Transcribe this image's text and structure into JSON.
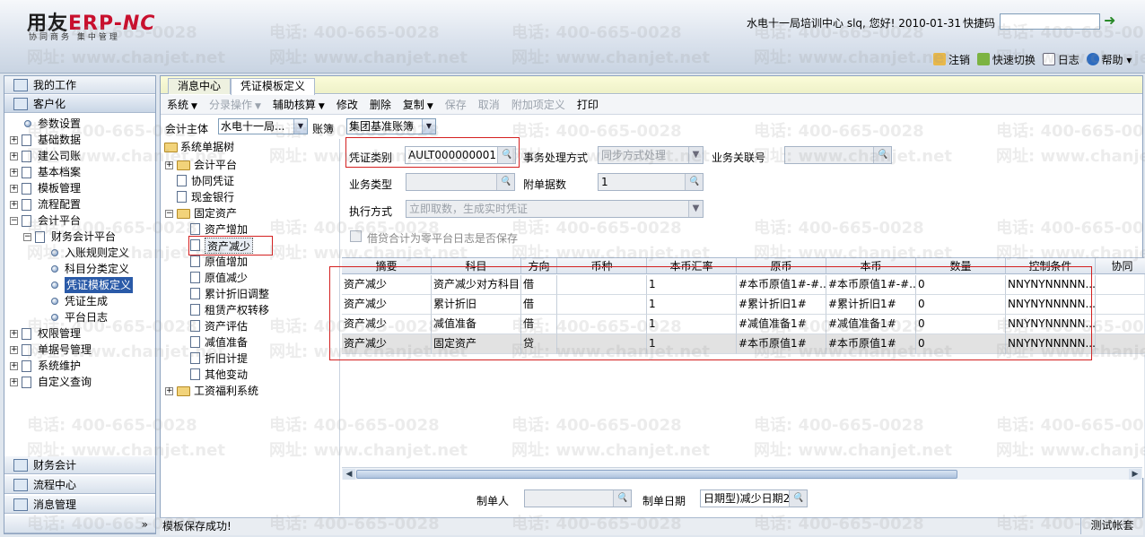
{
  "header": {
    "logo_brand": "用友",
    "logo_erp": "ERP-",
    "logo_nc": "NC",
    "logo_sub": "协同商务  集中管理",
    "user_info": "水电十一局培训中心 slq, 您好! 2010-01-31",
    "shortcut_label": "快捷码",
    "links": [
      "注销",
      "快速切换",
      "日志",
      "帮助"
    ]
  },
  "nav": {
    "top_sections": [
      "我的工作",
      "客户化"
    ],
    "tree": [
      {
        "label": "参数设置",
        "type": "leaf"
      },
      {
        "label": "基础数据",
        "type": "group"
      },
      {
        "label": "建公司账",
        "type": "group"
      },
      {
        "label": "基本档案",
        "type": "group"
      },
      {
        "label": "模板管理",
        "type": "group"
      },
      {
        "label": "流程配置",
        "type": "group"
      },
      {
        "label": "会计平台",
        "type": "open"
      },
      {
        "label": "财务会计平台",
        "type": "open"
      },
      {
        "label": "入账规则定义",
        "type": "leaf"
      },
      {
        "label": "科目分类定义",
        "type": "leaf"
      },
      {
        "label": "凭证模板定义",
        "type": "leaf",
        "selected": true
      },
      {
        "label": "凭证生成",
        "type": "leaf"
      },
      {
        "label": "平台日志",
        "type": "leaf"
      },
      {
        "label": "权限管理",
        "type": "group"
      },
      {
        "label": "单据号管理",
        "type": "group"
      },
      {
        "label": "系统维护",
        "type": "group"
      },
      {
        "label": "自定义查询",
        "type": "group"
      }
    ],
    "bottom_sections": [
      "财务会计",
      "流程中心",
      "消息管理"
    ],
    "collapse_glyph": "»"
  },
  "tabs": [
    "消息中心",
    "凭证模板定义"
  ],
  "menu": [
    {
      "label": "系统",
      "arrow": true,
      "enabled": true
    },
    {
      "label": "分录操作",
      "arrow": true,
      "enabled": false
    },
    {
      "label": "辅助核算",
      "arrow": true,
      "enabled": true
    },
    {
      "label": "修改",
      "enabled": true
    },
    {
      "label": "删除",
      "enabled": true
    },
    {
      "label": "复制",
      "arrow": true,
      "enabled": true
    },
    {
      "label": "保存",
      "enabled": false
    },
    {
      "label": "取消",
      "enabled": false
    },
    {
      "label": "附加项定义",
      "enabled": false
    },
    {
      "label": "打印",
      "enabled": true
    }
  ],
  "filter": {
    "entity_label": "会计主体",
    "entity_value": "水电十一局...",
    "book_label": "账簿",
    "book_value": "集团基准账簿"
  },
  "doc_tree": {
    "root": "系统单据树",
    "items": [
      {
        "label": "会计平台",
        "kind": "folder-closed"
      },
      {
        "label": "协同凭证",
        "kind": "doc"
      },
      {
        "label": "现金银行",
        "kind": "doc"
      },
      {
        "label": "固定资产",
        "kind": "folder-open"
      },
      {
        "label": "资产增加",
        "kind": "doc"
      },
      {
        "label": "资产减少",
        "kind": "doc",
        "selected": true
      },
      {
        "label": "原值增加",
        "kind": "doc"
      },
      {
        "label": "原值减少",
        "kind": "doc"
      },
      {
        "label": "累计折旧调整",
        "kind": "doc"
      },
      {
        "label": "租赁产权转移",
        "kind": "doc"
      },
      {
        "label": "资产评估",
        "kind": "doc"
      },
      {
        "label": "减值准备",
        "kind": "doc"
      },
      {
        "label": "折旧计提",
        "kind": "doc"
      },
      {
        "label": "其他变动",
        "kind": "doc"
      },
      {
        "label": "工资福利系统",
        "kind": "folder-closed"
      }
    ]
  },
  "form": {
    "voucher_type_label": "凭证类别",
    "voucher_type_value": "AULT000000001\")",
    "process_label": "事务处理方式",
    "process_value": "同步方式处理",
    "biz_link_label": "业务关联号",
    "biz_link_value": "",
    "biz_type_label": "业务类型",
    "biz_type_value": "",
    "attach_label": "附单据数",
    "attach_value": "1",
    "exec_label": "执行方式",
    "exec_value": "立即取数，生成实时凭证",
    "checkbox_label": "借贷合计为零平台日志是否保存"
  },
  "grid": {
    "columns": [
      "摘要",
      "科目",
      "方向",
      "币种",
      "本币汇率",
      "原币",
      "本币",
      "数量",
      "控制条件",
      "协同"
    ],
    "rows": [
      [
        "资产减少",
        "资产减少对方科目",
        "借",
        "",
        "1",
        "#本币原值1#-#...",
        "#本币原值1#-#...",
        "0",
        "NNYNYNNNNN...",
        ""
      ],
      [
        "资产减少",
        "累计折旧",
        "借",
        "",
        "1",
        "#累计折旧1#",
        "#累计折旧1#",
        "0",
        "NNYNYNNNNN...",
        ""
      ],
      [
        "资产减少",
        "减值准备",
        "借",
        "",
        "1",
        "#减值准备1#",
        "#减值准备1#",
        "0",
        "NNYNYNNNNN...",
        ""
      ],
      [
        "资产减少",
        "固定资产",
        "贷",
        "",
        "1",
        "#本币原值1#",
        "#本币原值1#",
        "0",
        "NNYNYNNNNN...",
        ""
      ]
    ]
  },
  "footer": {
    "maker_label": "制单人",
    "maker_value": "",
    "date_label": "制单日期",
    "date_value": "日期型)减少日期2#"
  },
  "status": {
    "message": "模板保存成功!",
    "right": "测试帐套"
  },
  "watermark": {
    "phone": "电话: 400-665-0028",
    "site": "网址: www.chanjet.net"
  }
}
